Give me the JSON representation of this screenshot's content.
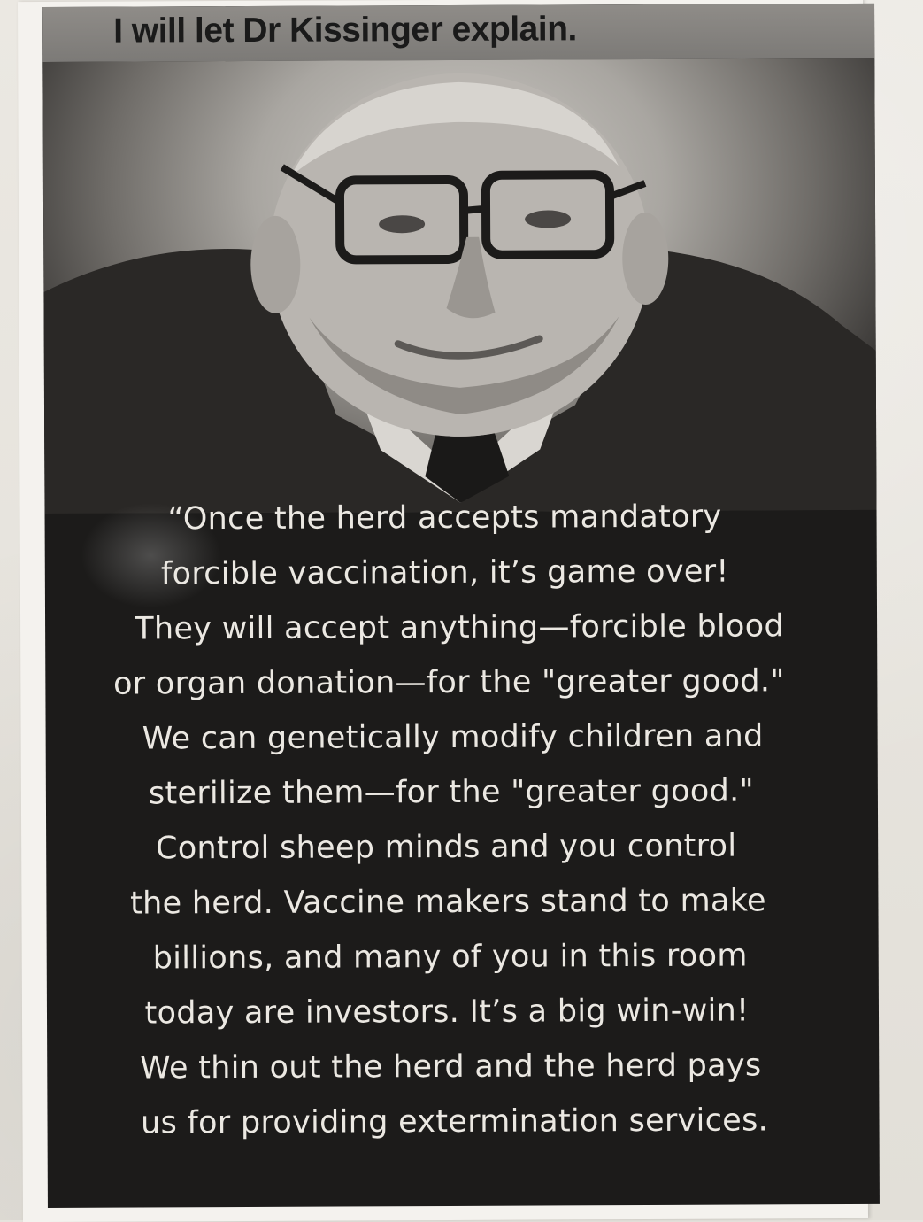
{
  "headline": "I will let Dr Kissinger explain.",
  "photo": {
    "subject": "portrait-photo"
  },
  "quote_lines": [
    "“Once the herd accepts mandatory",
    "forcible vaccination, it’s game over!",
    "They will accept anything—forcible blood",
    "or organ donation—for the \"greater good.\"",
    "We can genetically modify children and",
    "sterilize them—for the \"greater good.\"",
    "Control sheep minds and you control",
    "the herd.  Vaccine makers stand to make",
    "billions, and many of you in this room",
    "today are investors.  It’s a big win-win!",
    "We thin out the herd and the herd pays",
    "us for providing extermination services."
  ],
  "colors": {
    "print_background": "#1c1b1a",
    "quote_text": "#ebe8e2",
    "headline_band": "#85827e",
    "headline_text": "#1a1a1a",
    "paper": "#f4f2ee",
    "surface": "#e6e3dd"
  }
}
